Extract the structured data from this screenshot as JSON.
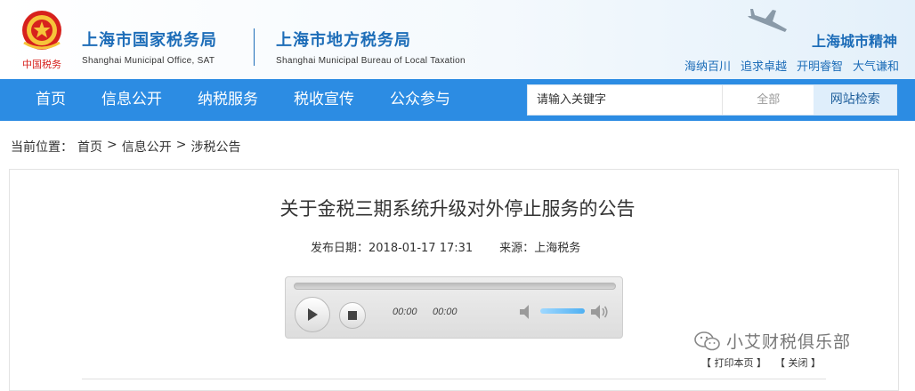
{
  "header": {
    "org1_cn": "上海市国家税务局",
    "org1_en": "Shanghai Municipal Office, SAT",
    "org2_cn": "上海市地方税务局",
    "org2_en": "Shanghai Municipal Bureau of Local Taxation",
    "city_title": "上海城市精神",
    "slogans": [
      "海纳百川",
      "追求卓越",
      "开明睿智",
      "大气谦和"
    ],
    "emblem_text": "中国税务"
  },
  "nav": {
    "items": [
      "首页",
      "信息公开",
      "纳税服务",
      "税收宣传",
      "公众参与"
    ]
  },
  "search": {
    "placeholder": "请输入关键字",
    "scope": "全部",
    "button": "网站检索"
  },
  "breadcrumb": {
    "label": "当前位置：",
    "items": [
      "首页",
      "信息公开",
      "涉税公告"
    ],
    "separator": ">"
  },
  "article": {
    "title": "关于金税三期系统升级对外停止服务的公告",
    "date_label": "发布日期：",
    "date": "2018-01-17 17:31",
    "source_label": "来源：",
    "source": "上海税务"
  },
  "player": {
    "current_time": "00:00",
    "duration": "00:00",
    "progress": 0,
    "volume": 1.0
  },
  "watermark": "小艾财税俱乐部",
  "actions": {
    "print": "【 打印本页 】",
    "close": "【 关闭 】"
  },
  "colors": {
    "brand_blue": "#1d6db8",
    "nav_blue": "#2c8ce3",
    "emblem_red": "#d7211d"
  }
}
